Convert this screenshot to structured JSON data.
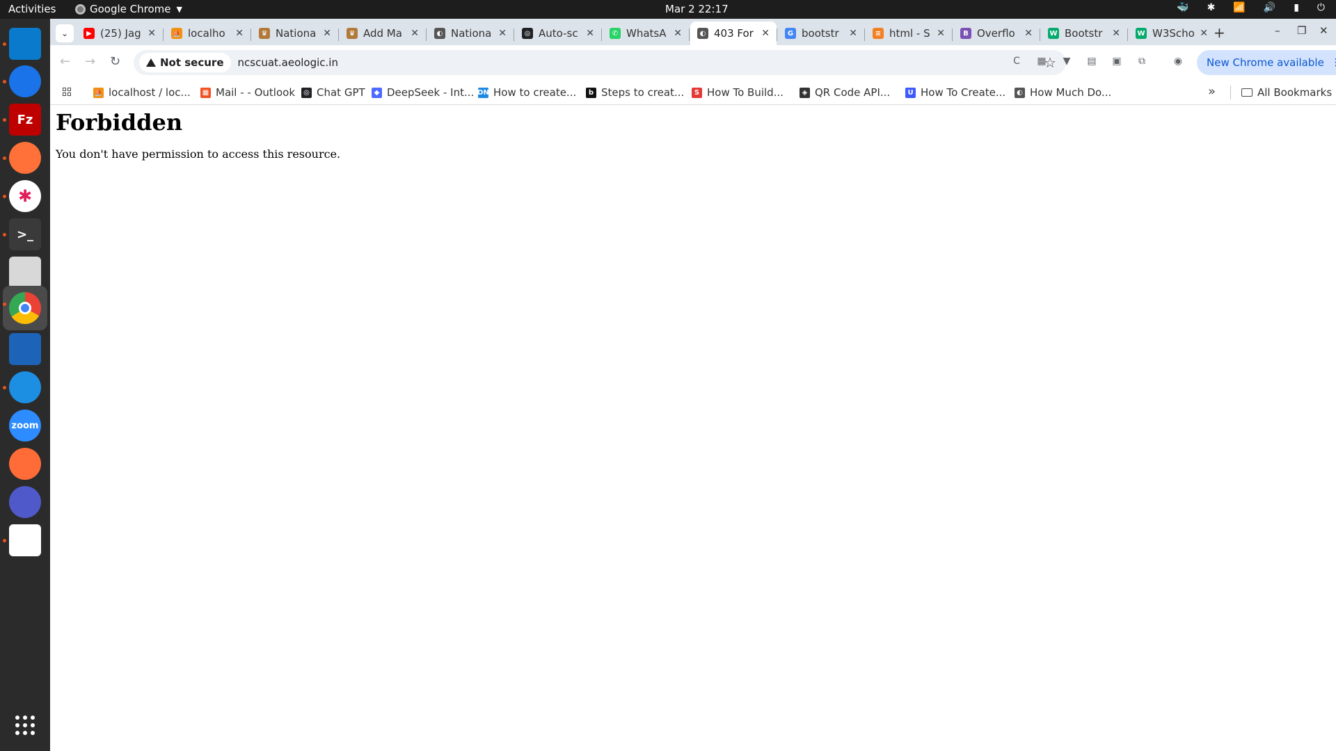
{
  "topbar": {
    "activities": "Activities",
    "app_name": "Google Chrome",
    "clock": "Mar 2  22:17"
  },
  "dock": {
    "items": [
      {
        "name": "vscode-icon",
        "color": "#0a7acc"
      },
      {
        "name": "thunderbird-icon",
        "color": "#1a73e8"
      },
      {
        "name": "filezilla-icon",
        "color": "#bf0000",
        "glyph": "Fz"
      },
      {
        "name": "firefox-icon",
        "color": "#ff7139"
      },
      {
        "name": "slack-icon",
        "color": "#ffffff"
      },
      {
        "name": "terminal-icon",
        "color": "#3a3a3a",
        "glyph": ">_"
      },
      {
        "name": "files-icon",
        "color": "#d8d8d8"
      },
      {
        "name": "chrome-icon",
        "color": "#34a853"
      },
      {
        "name": "writer-icon",
        "color": "#1d63b8"
      },
      {
        "name": "docker-icon",
        "color": "#1d8fe3"
      },
      {
        "name": "zoom-icon",
        "color": "#2d8cff",
        "glyph": "zoom"
      },
      {
        "name": "postman-icon",
        "color": "#ff6c37"
      },
      {
        "name": "teams-icon",
        "color": "#5059c9"
      },
      {
        "name": "text-editor-icon",
        "color": "#ffffff"
      }
    ]
  },
  "tabs": [
    {
      "title": "(25) Jag",
      "fav": "youtube",
      "color": "#ff0000"
    },
    {
      "title": "localho",
      "fav": "phpmyadmin",
      "color": "#f29111"
    },
    {
      "title": "Nationa",
      "fav": "emblem",
      "color": "#b07a3b"
    },
    {
      "title": "Add Ma",
      "fav": "emblem",
      "color": "#b07a3b"
    },
    {
      "title": "Nationa",
      "fav": "globe",
      "color": "#555555"
    },
    {
      "title": "Auto-sc",
      "fav": "chatgpt",
      "color": "#202124"
    },
    {
      "title": "WhatsA",
      "fav": "whatsapp",
      "color": "#25d366"
    },
    {
      "title": "403 For",
      "fav": "globe",
      "color": "#555555",
      "active": true
    },
    {
      "title": "bootstr",
      "fav": "google",
      "color": "#4285f4"
    },
    {
      "title": "html - S",
      "fav": "stackoverflow",
      "color": "#f48024"
    },
    {
      "title": "Overflo",
      "fav": "bootstrap",
      "color": "#7952b3"
    },
    {
      "title": "Bootstr",
      "fav": "w3schools",
      "color": "#04aa6d"
    },
    {
      "title": "W3Scho",
      "fav": "w3schools",
      "color": "#04aa6d"
    }
  ],
  "omnibox": {
    "security": "Not secure",
    "url": "ncscuat.aeologic.in"
  },
  "update_button": "New Chrome available",
  "bookmarks": [
    {
      "label": "localhost / loc...",
      "fav": "phpmyadmin",
      "color": "#f29111"
    },
    {
      "label": "Mail - - Outlook",
      "fav": "microsoft",
      "color": "#f25022"
    },
    {
      "label": "Chat GPT",
      "fav": "chatgpt",
      "color": "#202124"
    },
    {
      "label": "DeepSeek - Int...",
      "fav": "deepseek",
      "color": "#4d6bfe"
    },
    {
      "label": "How to create...",
      "fav": "dn",
      "color": "#1e88e5"
    },
    {
      "label": "Steps to creat...",
      "fav": "b",
      "color": "#111111"
    },
    {
      "label": "How To Build...",
      "fav": "stackhawk",
      "color": "#e53935"
    },
    {
      "label": "QR Code API...",
      "fav": "qr",
      "color": "#333333"
    },
    {
      "label": "How To Create...",
      "fav": "u",
      "color": "#3d5afe"
    },
    {
      "label": "How Much Do...",
      "fav": "globe",
      "color": "#555555"
    }
  ],
  "all_bookmarks": "All Bookmarks",
  "page": {
    "heading": "Forbidden",
    "message": "You don't have permission to access this resource."
  }
}
